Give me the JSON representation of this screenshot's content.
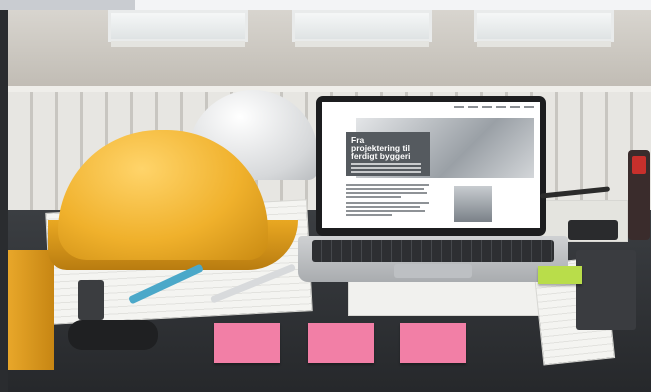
{
  "image": {
    "scene": "construction desk with helmets, laptop and plans"
  },
  "laptop_site": {
    "logo": "",
    "hero_title": "Fra\nprojektering til\nferdigt byggeri"
  },
  "colors": {
    "helmet_yellow": "#f0b12c",
    "helmet_white": "#e6e8ea",
    "sticky_pink": "#f27fa6",
    "hero_box": "#555a5f"
  }
}
